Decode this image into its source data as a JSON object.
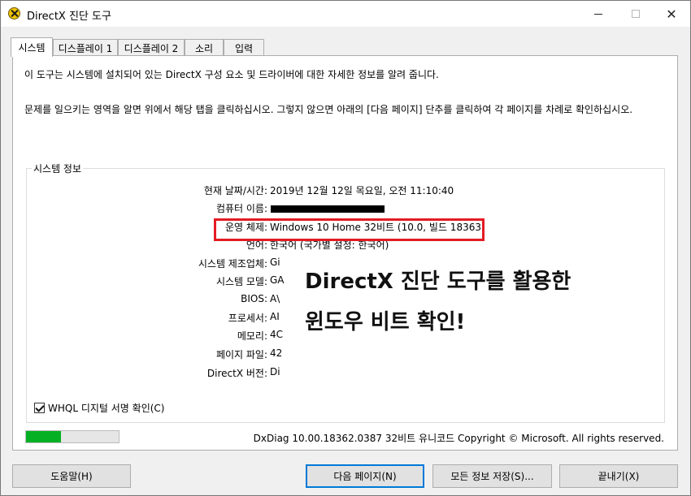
{
  "window": {
    "title": "DirectX 진단 도구"
  },
  "tabs": [
    {
      "label": "시스템"
    },
    {
      "label": "디스플레이 1"
    },
    {
      "label": "디스플레이 2"
    },
    {
      "label": "소리"
    },
    {
      "label": "입력"
    }
  ],
  "intro": {
    "line1": "이 도구는 시스템에 설치되어 있는 DirectX 구성 요소 및 드라이버에 대한 자세한 정보를 알려 줍니다.",
    "line2": "문제를 일으키는 영역을 알면 위에서 해당 탭을 클릭하십시오. 그렇지 않으면 아래의 [다음 페이지] 단추를 클릭하여 각 페이지를 차례로 확인하십시오."
  },
  "system_info": {
    "group_label": "시스템 정보",
    "rows": [
      {
        "label": "현재 날짜/시간:",
        "value": "2019년 12월 12일 목요일, 오전 11:10:40"
      },
      {
        "label": "컴퓨터 이름:",
        "value": ""
      },
      {
        "label": "운영 체제:",
        "value": "Windows 10 Home 32비트 (10.0, 빌드 18363)"
      },
      {
        "label": "언어:",
        "value": "한국어 (국가별 설정: 한국어)"
      },
      {
        "label": "시스템 제조업체:",
        "value": "Gi"
      },
      {
        "label": "시스템 모델:",
        "value": "GA"
      },
      {
        "label": "BIOS:",
        "value": "A\\"
      },
      {
        "label": "프로세서:",
        "value": "AI"
      },
      {
        "label": "메모리:",
        "value": "4C"
      },
      {
        "label": "페이지 파일:",
        "value": "42"
      },
      {
        "label": "DirectX 버전:",
        "value": "Di"
      }
    ]
  },
  "overlay": {
    "line1": "DirectX 진단 도구를 활용한",
    "line2": "윈도우 비트 확인!"
  },
  "whql": {
    "label": "WHQL 디지털 서명 확인(C)",
    "checked": true
  },
  "progress": {
    "fraction": 0.38,
    "color": "#06b025"
  },
  "footer": {
    "copyright": "DxDiag 10.00.18362.0387 32비트 유니코드  Copyright © Microsoft. All rights reserved."
  },
  "buttons": {
    "help": "도움말(H)",
    "next": "다음 페이지(N)",
    "save": "모든 정보 저장(S)...",
    "exit": "끝내기(X)"
  },
  "icons": {
    "app": "directx-icon",
    "minimize": "minimize-icon",
    "maximize": "maximize-icon",
    "close": "close-icon",
    "check": "checkmark-icon"
  },
  "colors": {
    "highlight": "#e41b23",
    "default_button_border": "#0078d7"
  }
}
